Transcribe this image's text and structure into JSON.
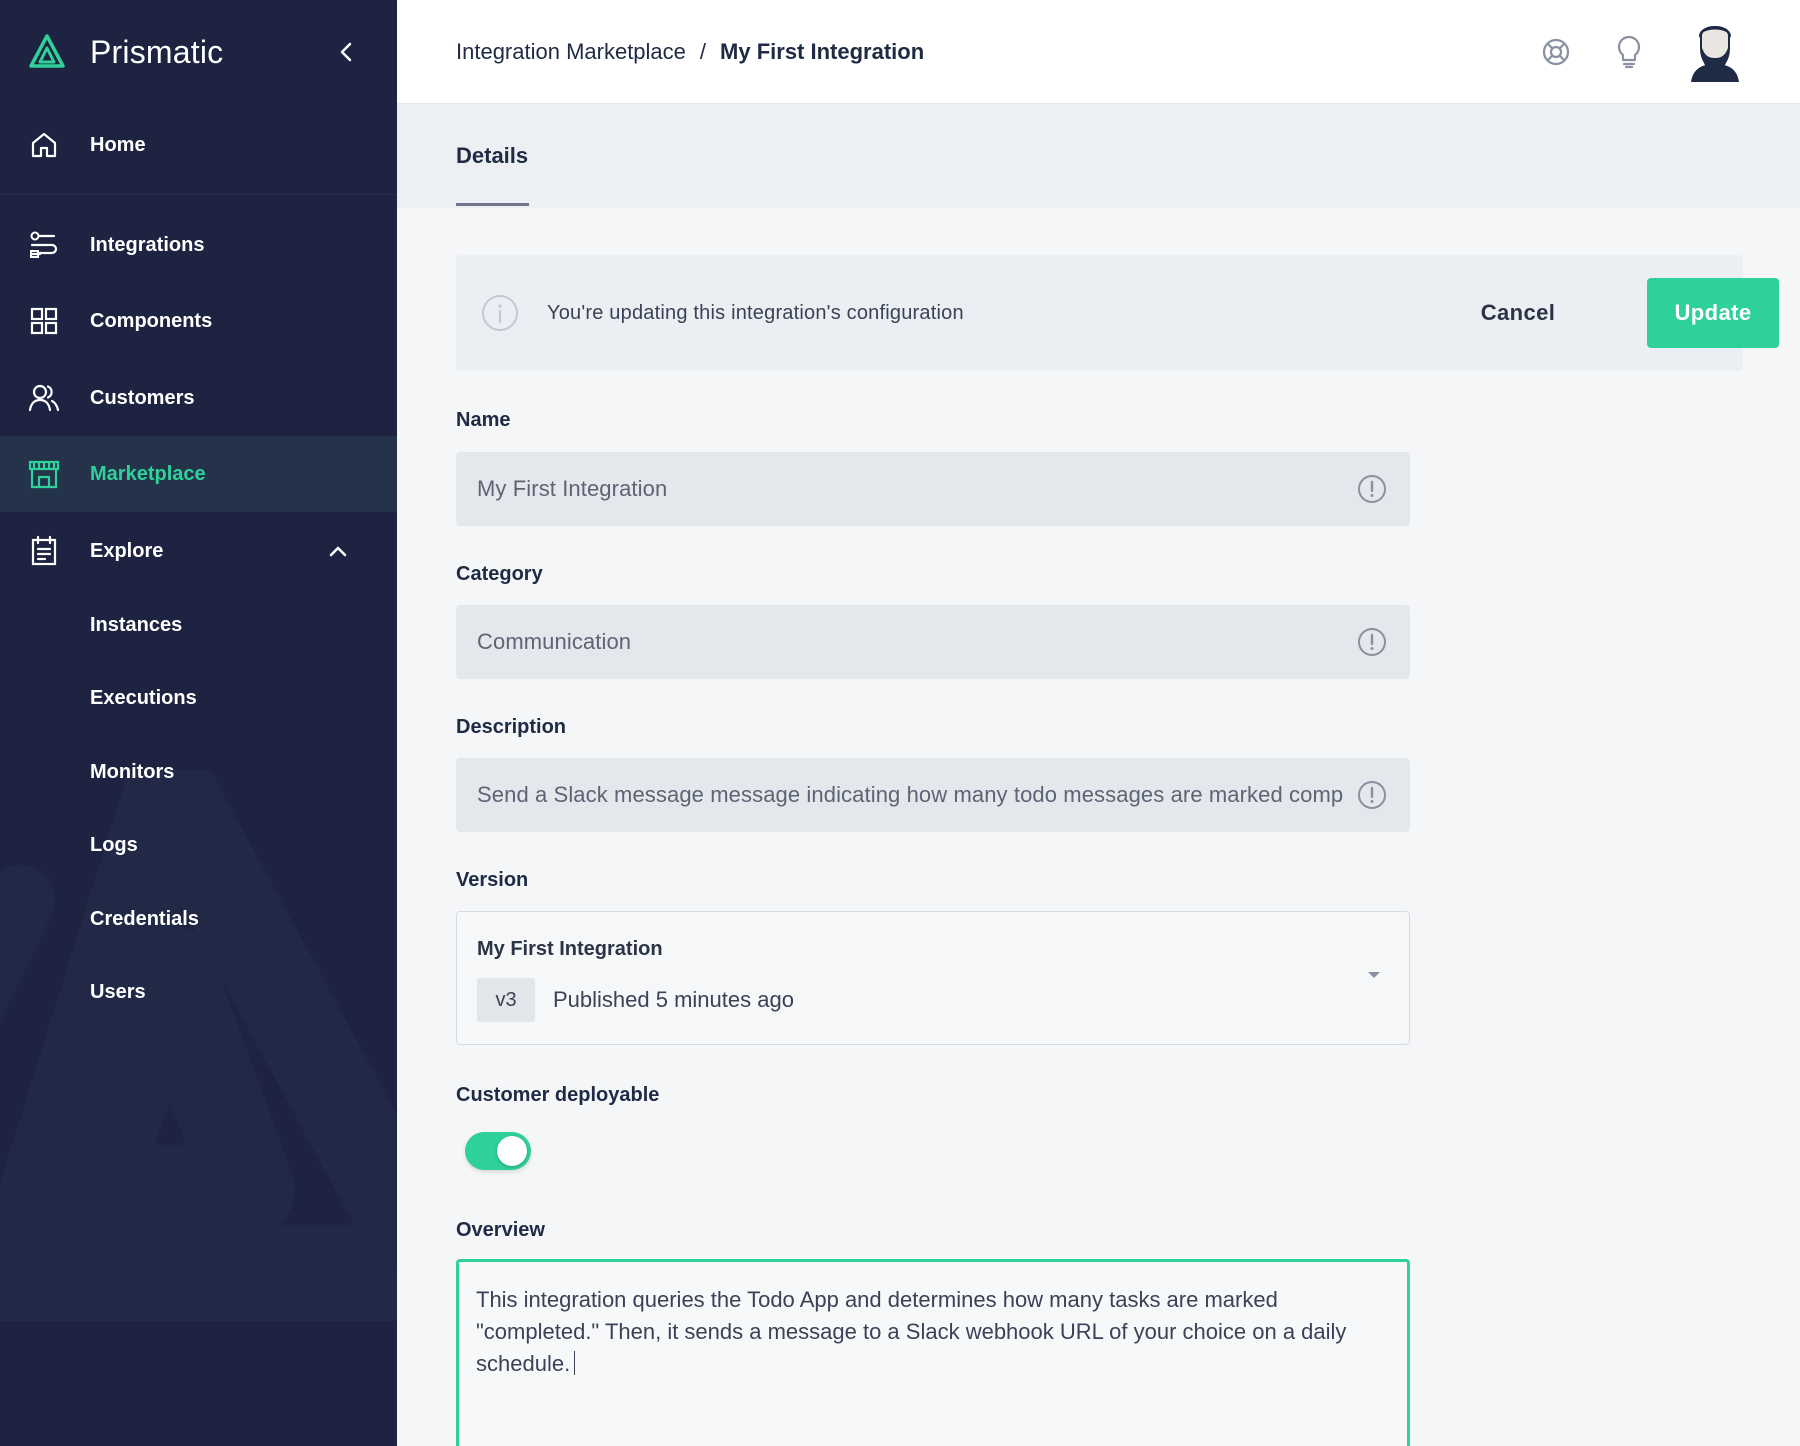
{
  "app": {
    "name": "Prismatic",
    "brand_color": "#2fd19b",
    "sidebar_color": "#1d2340"
  },
  "sidebar": {
    "items": [
      {
        "label": "Home",
        "icon": "home-icon"
      },
      {
        "label": "Integrations",
        "icon": "integrations-icon"
      },
      {
        "label": "Components",
        "icon": "components-grid-icon"
      },
      {
        "label": "Customers",
        "icon": "customers-icon"
      },
      {
        "label": "Marketplace",
        "icon": "marketplace-store-icon",
        "active": true
      },
      {
        "label": "Explore",
        "icon": "explore-clipboard-icon",
        "expanded": true
      }
    ],
    "explore_children": [
      "Instances",
      "Executions",
      "Monitors",
      "Logs",
      "Credentials",
      "Users"
    ]
  },
  "header": {
    "breadcrumb_parent": "Integration Marketplace",
    "breadcrumb_separator": "/",
    "breadcrumb_current": "My First Integration",
    "icons": [
      "support-lifebuoy-icon",
      "lightbulb-icon",
      "user-avatar"
    ]
  },
  "tabs": [
    {
      "label": "Details",
      "active": true
    }
  ],
  "banner": {
    "text": "You're updating this integration's configuration",
    "cancel_label": "Cancel",
    "update_label": "Update"
  },
  "form": {
    "name": {
      "label": "Name",
      "value": "My First Integration"
    },
    "category": {
      "label": "Category",
      "value": "Communication"
    },
    "description": {
      "label": "Description",
      "value": "Send a Slack message message indicating how many todo messages are marked comp"
    },
    "version": {
      "label": "Version",
      "title": "My First Integration",
      "badge": "v3",
      "published": "Published 5 minutes ago"
    },
    "customer_deployable": {
      "label": "Customer deployable",
      "enabled": true
    },
    "overview": {
      "label": "Overview",
      "value": "This integration queries the Todo App and determines how many tasks are marked \"completed.\" Then, it sends a message to a Slack webhook URL of your choice on a daily schedule."
    }
  }
}
